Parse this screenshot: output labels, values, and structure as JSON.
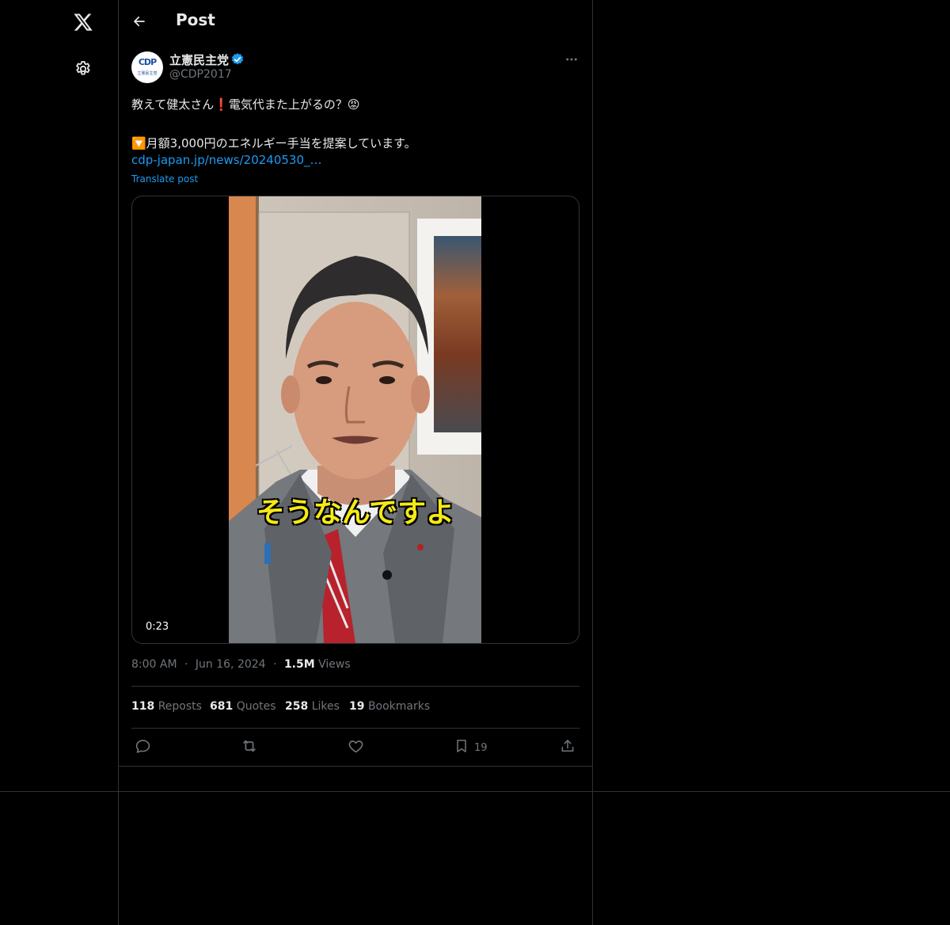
{
  "header": {
    "title": "Post"
  },
  "sidebar": {
    "items": [
      {
        "icon": "x-logo-icon"
      },
      {
        "icon": "gear-icon"
      }
    ]
  },
  "post": {
    "author_name": "立憲民主党",
    "author_handle": "@CDP2017",
    "avatar_text": "CDP",
    "avatar_subtext": "立憲民主党",
    "verified": true,
    "text_line1": "教えて健太さん❗電気代また上がるの？😡",
    "text_line2": "🔽月額3,000円のエネルギー手当を提案しています。",
    "link_text": "cdp-japan.jp/news/20240530_…",
    "translate_label": "Translate post",
    "video": {
      "caption": "そうなんですよ",
      "duration": "0:23"
    },
    "time": "8:00 AM",
    "date": "Jun 16, 2024",
    "views_count": "1.5M",
    "views_label": "Views",
    "separator": "·",
    "stats": {
      "reposts_count": "118",
      "reposts_label": "Reposts",
      "quotes_count": "681",
      "quotes_label": "Quotes",
      "likes_count": "258",
      "likes_label": "Likes",
      "bookmarks_count": "19",
      "bookmarks_label": "Bookmarks"
    },
    "actions": {
      "bookmark_count": "19"
    }
  },
  "colors": {
    "background": "#000000",
    "border": "#2f3336",
    "link": "#1d9bf0",
    "muted": "#71767b",
    "text": "#e7e9ea",
    "caption": "#f5ea14"
  }
}
